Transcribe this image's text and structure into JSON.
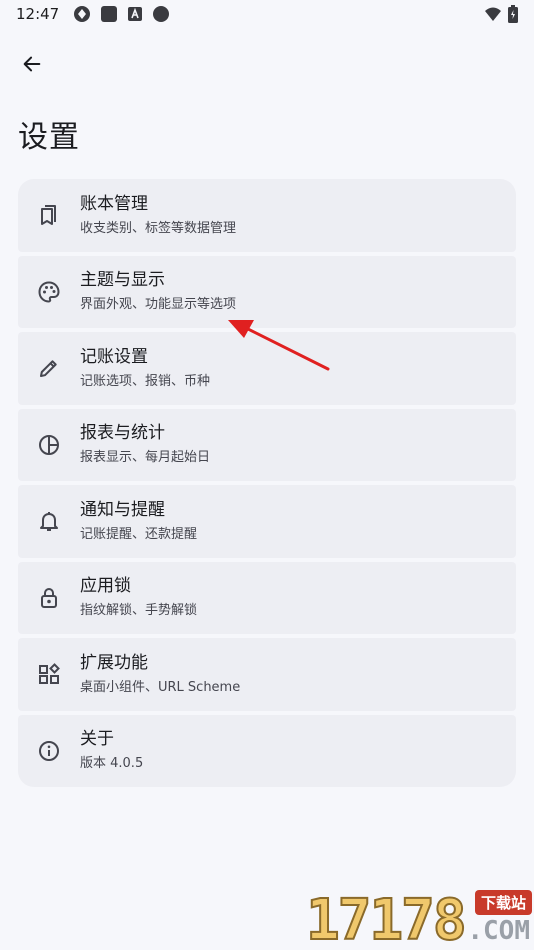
{
  "status_bar": {
    "time": "12:47",
    "icons": [
      "sync-icon",
      "square-icon",
      "a-badge-icon",
      "circle-icon"
    ],
    "right_icons": [
      "wifi-icon",
      "battery-icon"
    ]
  },
  "header": {
    "back_icon": "arrow-left-icon",
    "title": "设置"
  },
  "settings": {
    "items": [
      {
        "icon": "book-icon",
        "title": "账本管理",
        "subtitle": "收支类别、标签等数据管理"
      },
      {
        "icon": "palette-icon",
        "title": "主题与显示",
        "subtitle": "界面外观、功能显示等选项"
      },
      {
        "icon": "pencil-icon",
        "title": "记账设置",
        "subtitle": "记账选项、报销、币种"
      },
      {
        "icon": "pie-chart-icon",
        "title": "报表与统计",
        "subtitle": "报表显示、每月起始日"
      },
      {
        "icon": "bell-icon",
        "title": "通知与提醒",
        "subtitle": "记账提醒、还款提醒"
      },
      {
        "icon": "lock-icon",
        "title": "应用锁",
        "subtitle": "指纹解锁、手势解锁"
      },
      {
        "icon": "widgets-icon",
        "title": "扩展功能",
        "subtitle": "桌面小组件、URL Scheme"
      },
      {
        "icon": "info-icon",
        "title": "关于",
        "subtitle": "版本 4.0.5"
      }
    ]
  },
  "annotation": {
    "color": "#e02020"
  },
  "watermark": {
    "number": "17178",
    "badge": "下载站",
    "suffix": ".COM"
  }
}
